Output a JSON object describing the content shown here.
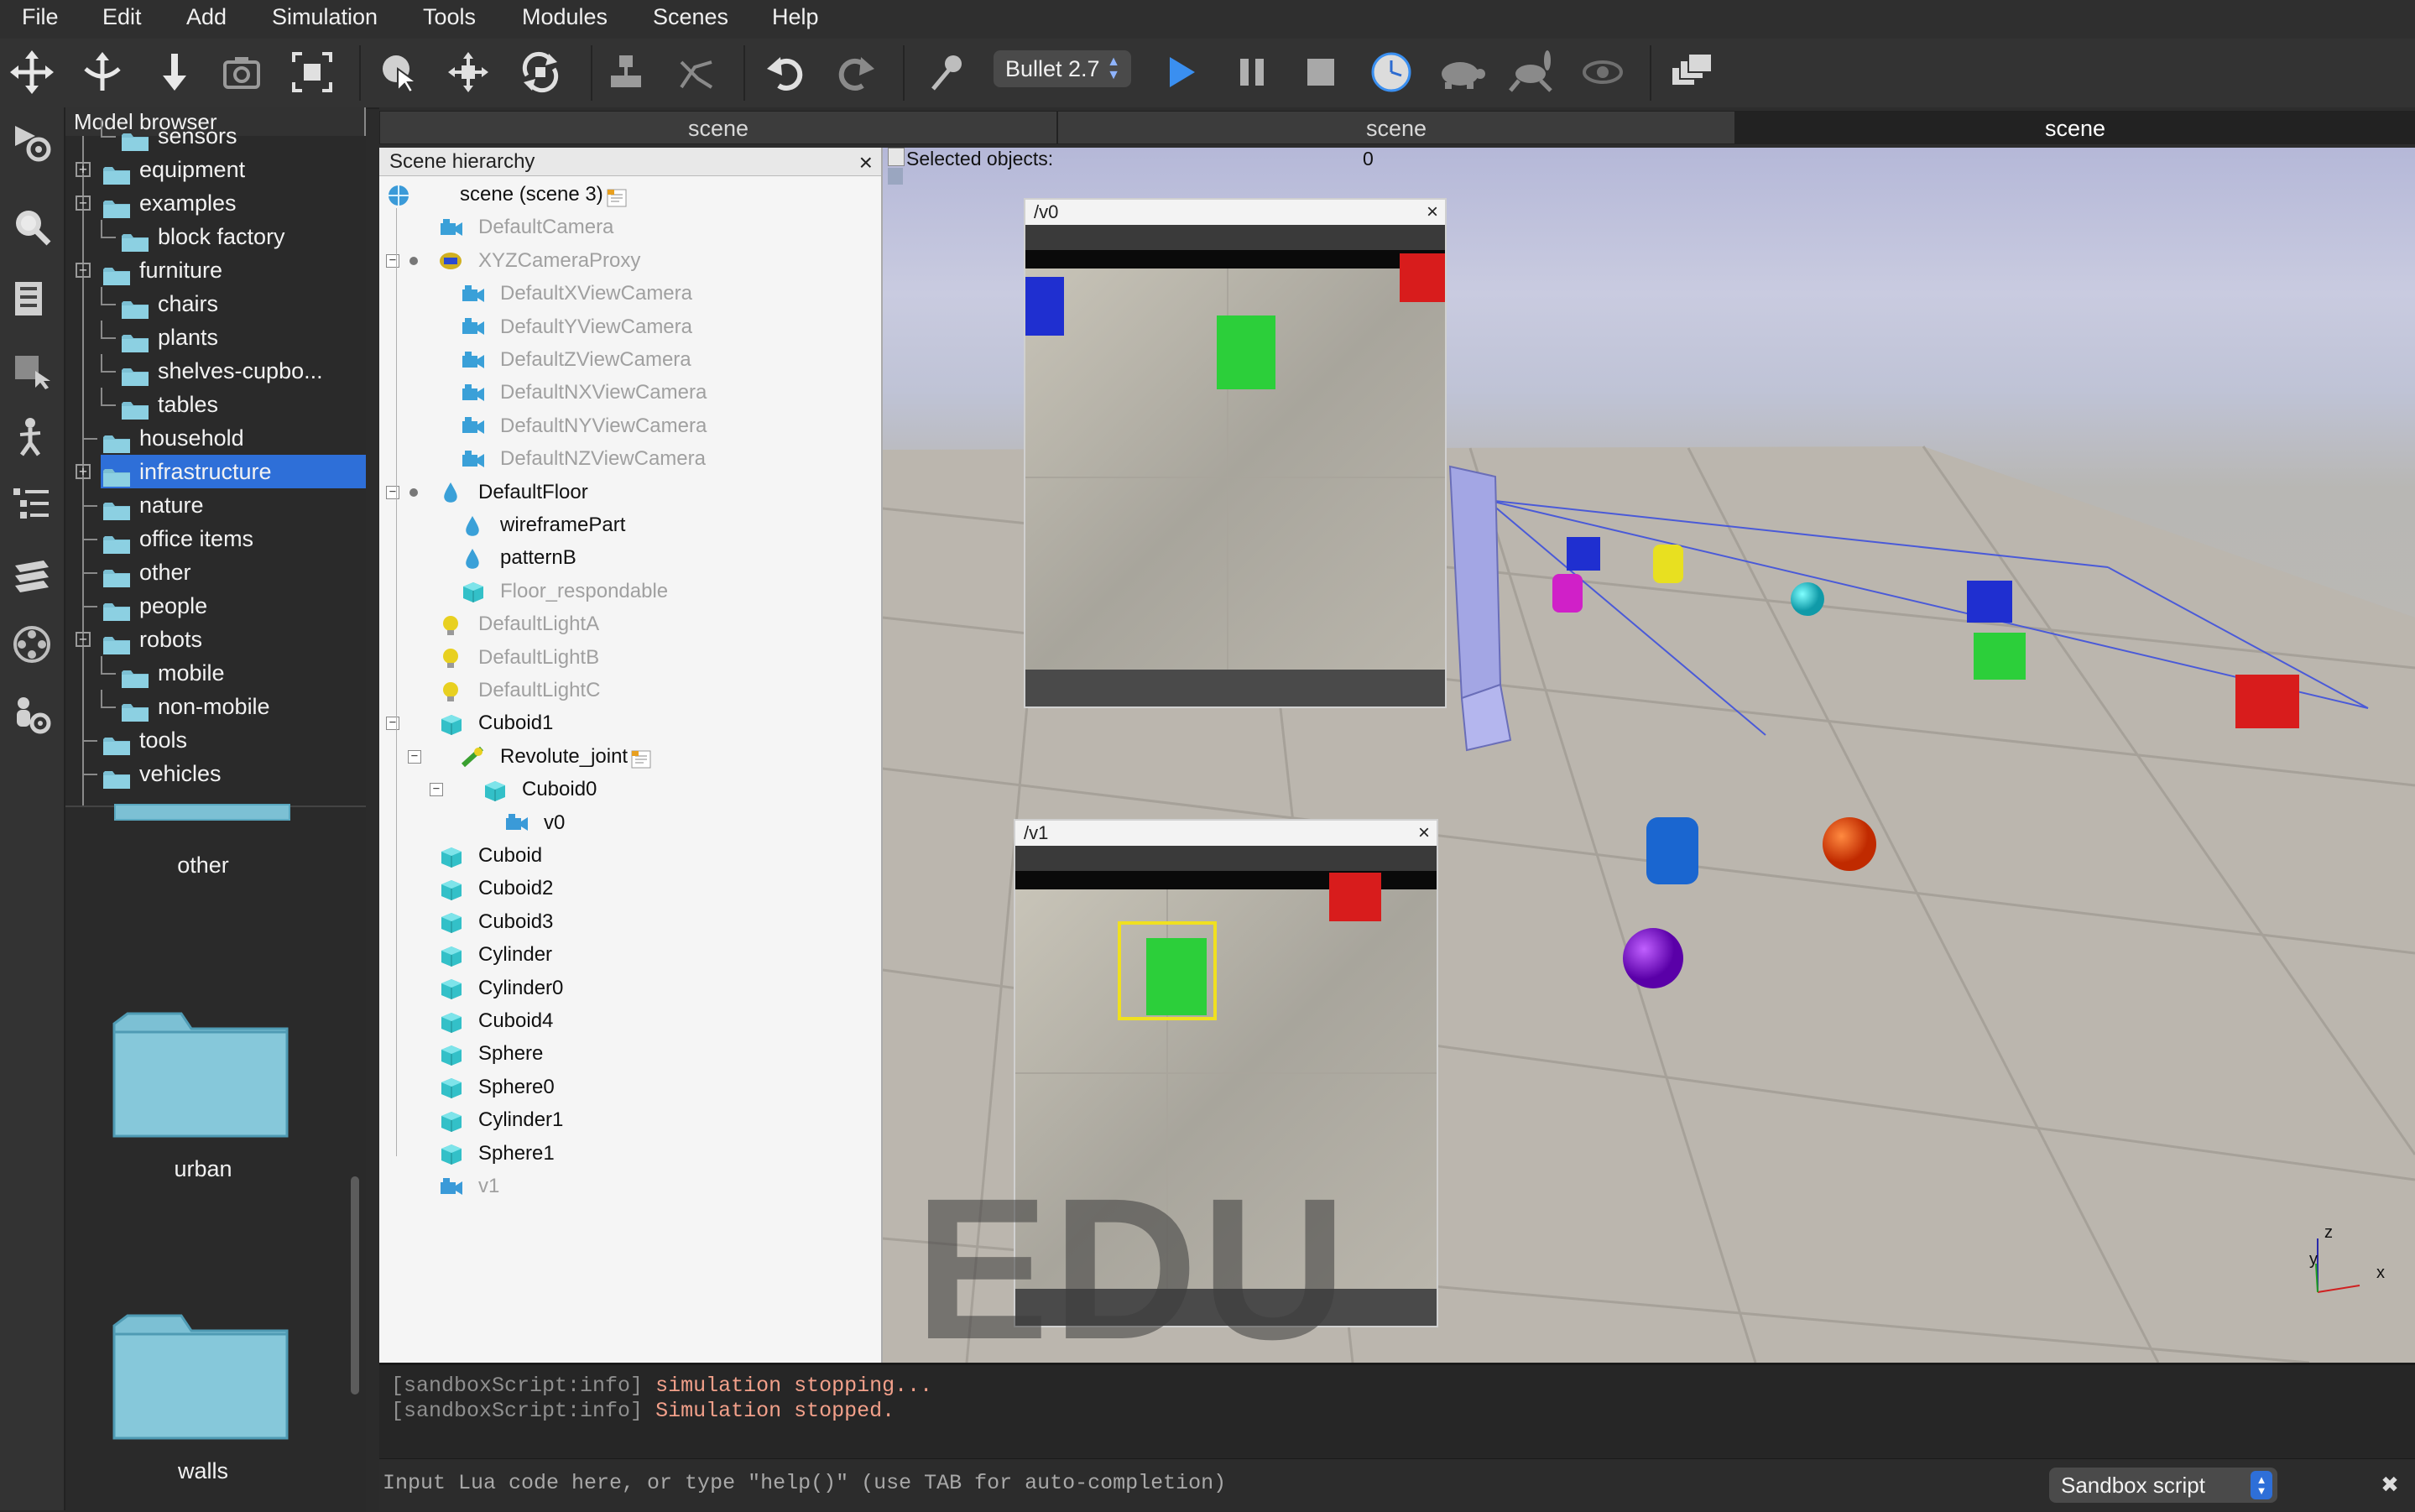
{
  "menu": [
    "File",
    "Edit",
    "Add",
    "Simulation",
    "Tools",
    "Modules",
    "Scenes",
    "Help"
  ],
  "toolbar": {
    "engine_label": "Bullet 2.7",
    "icons": [
      "move-camera-icon",
      "rotate-camera-icon",
      "shift-camera-icon",
      "fit-view-icon",
      "camera-angle-icon",
      "click-select-icon",
      "object-shift-icon",
      "object-rotate-icon",
      "assemble-icon",
      "transfer-dna-icon",
      "undo-icon",
      "redo-icon",
      "dynamics-toggle-icon",
      "play-icon",
      "pause-icon",
      "stop-icon",
      "realtime-icon",
      "slow-down-icon",
      "speed-up-icon",
      "visualization-toggle-icon",
      "page-selector-icon"
    ]
  },
  "model_browser": {
    "title": "Model browser",
    "items": [
      {
        "label": "sensors"
      },
      {
        "label": "equipment"
      },
      {
        "label": "examples"
      },
      {
        "label": "block factory"
      },
      {
        "label": "furniture"
      },
      {
        "label": "chairs"
      },
      {
        "label": "plants"
      },
      {
        "label": "shelves-cupbo..."
      },
      {
        "label": "tables"
      },
      {
        "label": "household"
      },
      {
        "label": "infrastructure"
      },
      {
        "label": "nature"
      },
      {
        "label": "office items"
      },
      {
        "label": "other"
      },
      {
        "label": "people"
      },
      {
        "label": "robots"
      },
      {
        "label": "mobile"
      },
      {
        "label": "non-mobile"
      },
      {
        "label": "tools"
      },
      {
        "label": "vehicles"
      }
    ],
    "thumbnails": [
      "other",
      "urban",
      "walls"
    ]
  },
  "scene_tabs": [
    "scene",
    "scene",
    "scene"
  ],
  "hierarchy": {
    "title": "Scene hierarchy",
    "rows": [
      {
        "label": "scene (scene 3)"
      },
      {
        "label": "DefaultCamera"
      },
      {
        "label": "XYZCameraProxy"
      },
      {
        "label": "DefaultXViewCamera"
      },
      {
        "label": "DefaultYViewCamera"
      },
      {
        "label": "DefaultZViewCamera"
      },
      {
        "label": "DefaultNXViewCamera"
      },
      {
        "label": "DefaultNYViewCamera"
      },
      {
        "label": "DefaultNZViewCamera"
      },
      {
        "label": "DefaultFloor"
      },
      {
        "label": "wireframePart"
      },
      {
        "label": "patternB"
      },
      {
        "label": "Floor_respondable"
      },
      {
        "label": "DefaultLightA"
      },
      {
        "label": "DefaultLightB"
      },
      {
        "label": "DefaultLightC"
      },
      {
        "label": "Cuboid1"
      },
      {
        "label": "Revolute_joint"
      },
      {
        "label": "Cuboid0"
      },
      {
        "label": "v0"
      },
      {
        "label": "Cuboid"
      },
      {
        "label": "Cuboid2"
      },
      {
        "label": "Cuboid3"
      },
      {
        "label": "Cylinder"
      },
      {
        "label": "Cylinder0"
      },
      {
        "label": "Cuboid4"
      },
      {
        "label": "Sphere"
      },
      {
        "label": "Sphere0"
      },
      {
        "label": "Cylinder1"
      },
      {
        "label": "Sphere1"
      },
      {
        "label": "v1"
      }
    ]
  },
  "viewport": {
    "selected_label": "Selected objects:",
    "selected_count": "0",
    "view0_title": "/v0",
    "view1_title": "/v1",
    "watermark": "EDU",
    "axis_z": "z",
    "axis_y": "y",
    "axis_x": "x"
  },
  "console": {
    "lines": [
      {
        "tag": "[sandboxScript:info]",
        "msg": "simulation stopping..."
      },
      {
        "tag": "[sandboxScript:info]",
        "msg": "Simulation stopped."
      }
    ],
    "input_placeholder": "Input Lua code here, or type \"help()\" (use TAB for auto-completion)",
    "script_select": "Sandbox script"
  },
  "colors": {
    "selection": "#2e6fd8",
    "cube_blue": "#1f2fd0",
    "cube_green": "#2ccf3a",
    "cube_red": "#d81c1c",
    "cyl_yellow": "#e8e020",
    "cyl_magenta": "#d020c8",
    "sphere_cyan": "#20c8d0",
    "sphere_orange": "#e04010",
    "sphere_purple": "#8a1ad8"
  }
}
